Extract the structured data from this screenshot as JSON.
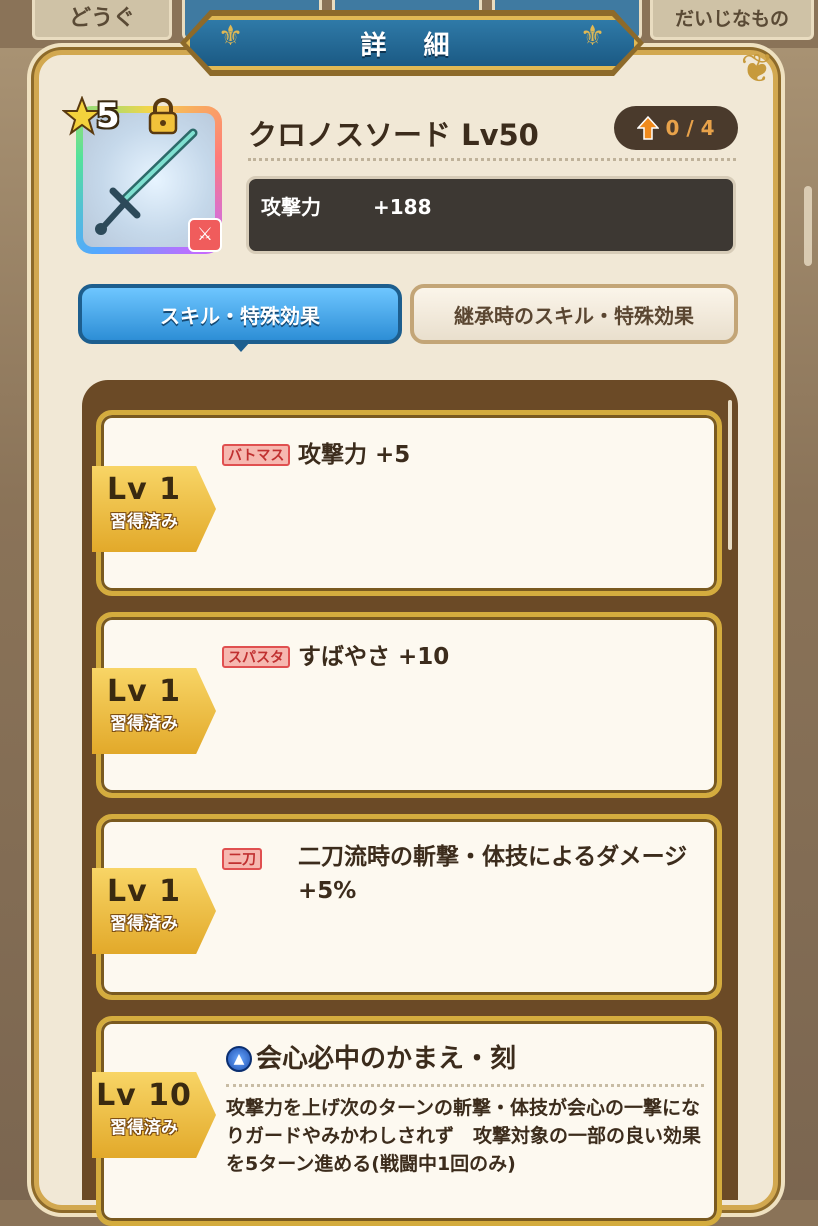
{
  "background_tabs": [
    "どうぐ",
    "",
    "",
    "",
    "だいじなもの"
  ],
  "dialog": {
    "title": "詳 細"
  },
  "item": {
    "rarity": "5",
    "name": "クロノスソード Lv50",
    "upgrade": "0 / 4",
    "stat_label": "攻撃力",
    "stat_value": "+188"
  },
  "tabs": {
    "active": "スキル・特殊効果",
    "inactive": "継承時のスキル・特殊効果"
  },
  "skills": [
    {
      "level": "Lv 1",
      "status": "習得済み",
      "tag": "バトマス",
      "text": "攻撃力 +5"
    },
    {
      "level": "Lv 1",
      "status": "習得済み",
      "tag": "スパスタ",
      "text": "すばやさ +10"
    },
    {
      "level": "Lv 1",
      "status": "習得済み",
      "tag": "二刀",
      "text": "二刀流時の斬撃・体技によるダメージ +5%"
    },
    {
      "level": "Lv 10",
      "status": "習得済み",
      "name": "会心必中のかまえ・刻",
      "description": "攻撃力を上げ次のターンの斬撃・体技が会心の一撃になりガードやみかわしされず　攻撃対象の一部の良い効果を5ターン進める(戦闘中1回のみ)"
    }
  ],
  "colors": {
    "accent_blue": "#2d8ed6",
    "gold": "#d4ac3e",
    "panel": "#f1e8d6",
    "list_bg": "#6b4a26",
    "upgrade_orange": "#e8a24a"
  },
  "icons": [
    "star-icon",
    "lock-icon",
    "sword-icon",
    "upgrade-arrow-icon",
    "skill-type-icon",
    "fleur-icon"
  ]
}
